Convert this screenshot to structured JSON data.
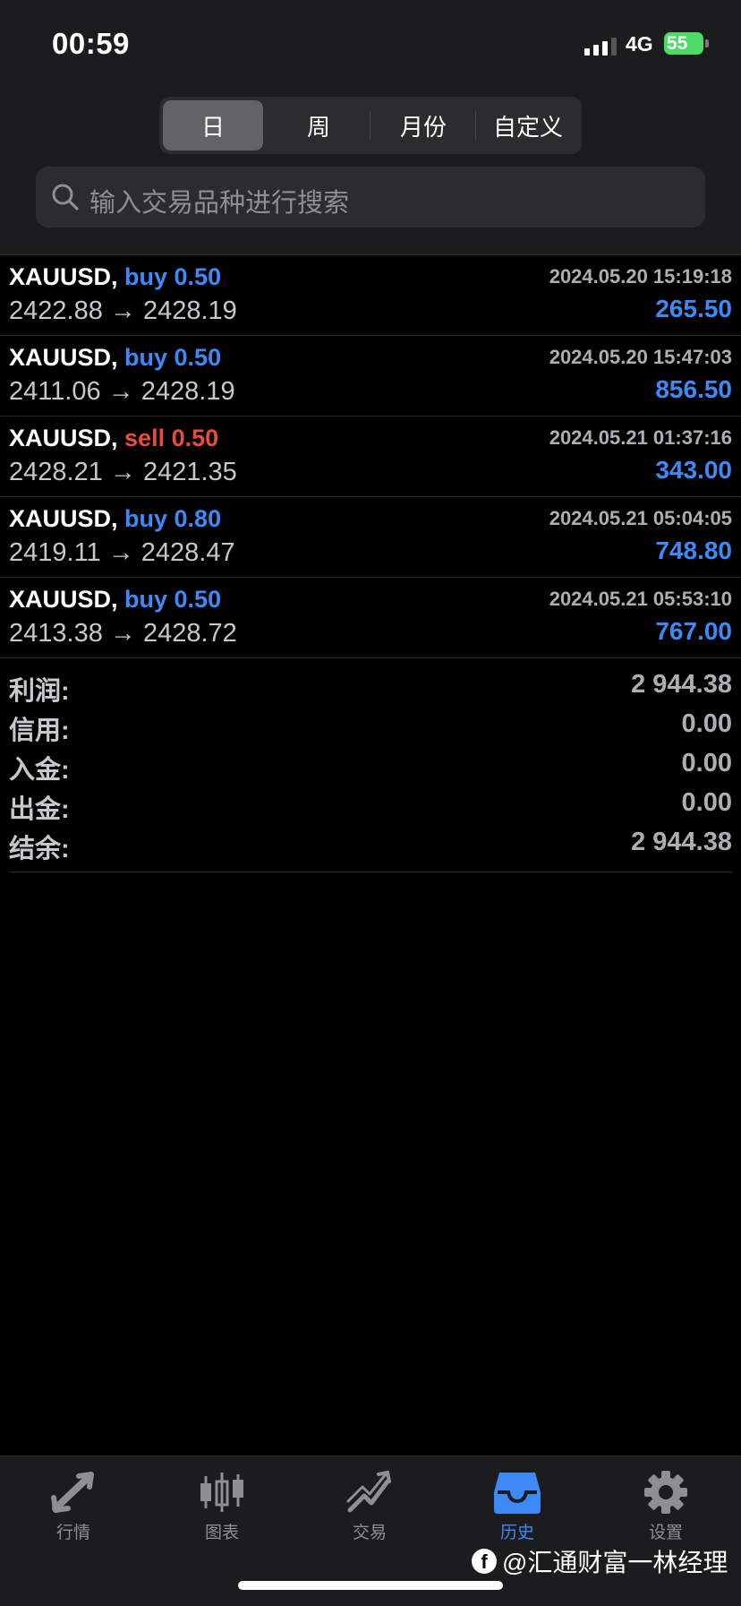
{
  "status_bar": {
    "time": "00:59",
    "network": "4G",
    "battery": "55"
  },
  "period_tabs": [
    {
      "label": "日",
      "active": true
    },
    {
      "label": "周",
      "active": false
    },
    {
      "label": "月份",
      "active": false
    },
    {
      "label": "自定义",
      "active": false
    }
  ],
  "search": {
    "placeholder": "输入交易品种进行搜索"
  },
  "trades": [
    {
      "symbol": "XAUUSD,",
      "side": "buy 0.50",
      "type": "buy",
      "prices": "2422.88 → 2428.19",
      "datetime": "2024.05.20 15:19:18",
      "profit": "265.50"
    },
    {
      "symbol": "XAUUSD,",
      "side": "buy 0.50",
      "type": "buy",
      "prices": "2411.06 → 2428.19",
      "datetime": "2024.05.20 15:47:03",
      "profit": "856.50"
    },
    {
      "symbol": "XAUUSD,",
      "side": "sell 0.50",
      "type": "sell",
      "prices": "2428.21 → 2421.35",
      "datetime": "2024.05.21 01:37:16",
      "profit": "343.00"
    },
    {
      "symbol": "XAUUSD,",
      "side": "buy 0.80",
      "type": "buy",
      "prices": "2419.11 → 2428.47",
      "datetime": "2024.05.21 05:04:05",
      "profit": "748.80"
    },
    {
      "symbol": "XAUUSD,",
      "side": "buy 0.50",
      "type": "buy",
      "prices": "2413.38 → 2428.72",
      "datetime": "2024.05.21 05:53:10",
      "profit": "767.00"
    }
  ],
  "summary": [
    {
      "label": "利润:",
      "value": "2 944.38"
    },
    {
      "label": "信用:",
      "value": "0.00"
    },
    {
      "label": "入金:",
      "value": "0.00"
    },
    {
      "label": "出金:",
      "value": "0.00"
    },
    {
      "label": "结余:",
      "value": "2 944.38"
    }
  ],
  "tab_bar": [
    {
      "label": "行情",
      "icon": "quotes-arrows-icon",
      "active": false
    },
    {
      "label": "图表",
      "icon": "candlestick-chart-icon",
      "active": false
    },
    {
      "label": "交易",
      "icon": "trade-trend-icon",
      "active": false
    },
    {
      "label": "历史",
      "icon": "history-inbox-icon",
      "active": true
    },
    {
      "label": "设置",
      "icon": "gear-icon",
      "active": false
    }
  ],
  "watermark": "@汇通财富一林经理",
  "colors": {
    "buy": "#3d8af7",
    "sell": "#e74c3c",
    "profit": "#3d8af7",
    "accent": "#3d8af7"
  }
}
